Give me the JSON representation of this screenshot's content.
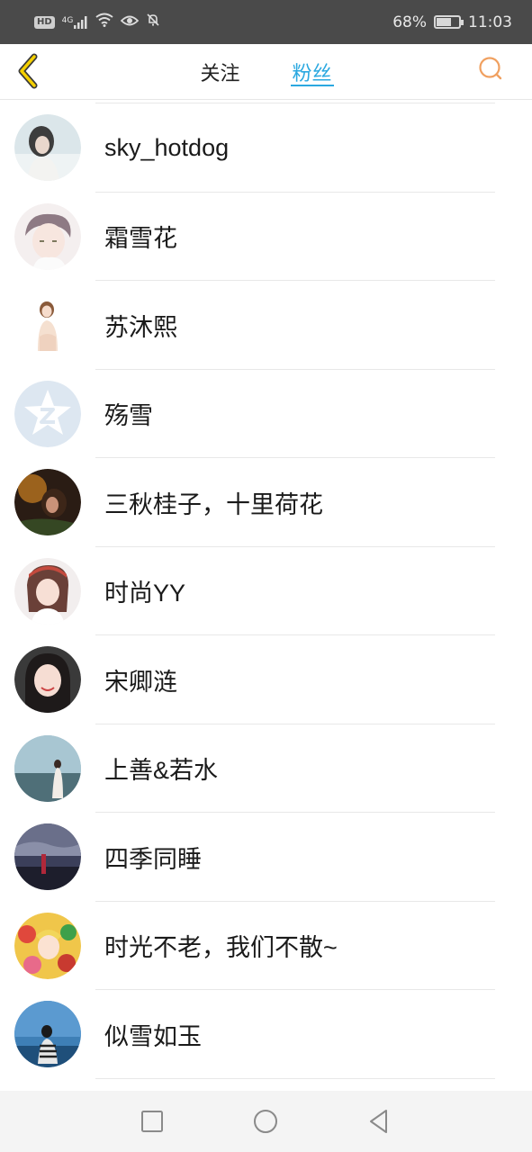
{
  "status_bar": {
    "hd_label": "HD",
    "network": "4G",
    "battery": "68%",
    "time": "11:03",
    "icons": [
      "signal-icon",
      "wifi-icon",
      "eye-icon",
      "mute-bell-icon",
      "battery-icon"
    ]
  },
  "header": {
    "tabs": [
      {
        "label": "关注",
        "active": false
      },
      {
        "label": "粉丝",
        "active": true
      }
    ],
    "accent_color": "#2aa8e0",
    "back_icon": "chevron-left-icon",
    "search_icon": "search-icon"
  },
  "fans": [
    {
      "name": "sky_hotdog"
    },
    {
      "name": "霜雪花"
    },
    {
      "name": "苏沐熙"
    },
    {
      "name": "殇雪"
    },
    {
      "name": "三秋桂子，十里荷花"
    },
    {
      "name": "时尚YY"
    },
    {
      "name": "宋卿涟"
    },
    {
      "name": "上善&若水"
    },
    {
      "name": "四季同睡"
    },
    {
      "name": "时光不老，我们不散~"
    },
    {
      "name": "似雪如玉"
    }
  ],
  "nav_bar": {
    "icons": [
      "square-recents-icon",
      "circle-home-icon",
      "triangle-back-icon"
    ]
  }
}
